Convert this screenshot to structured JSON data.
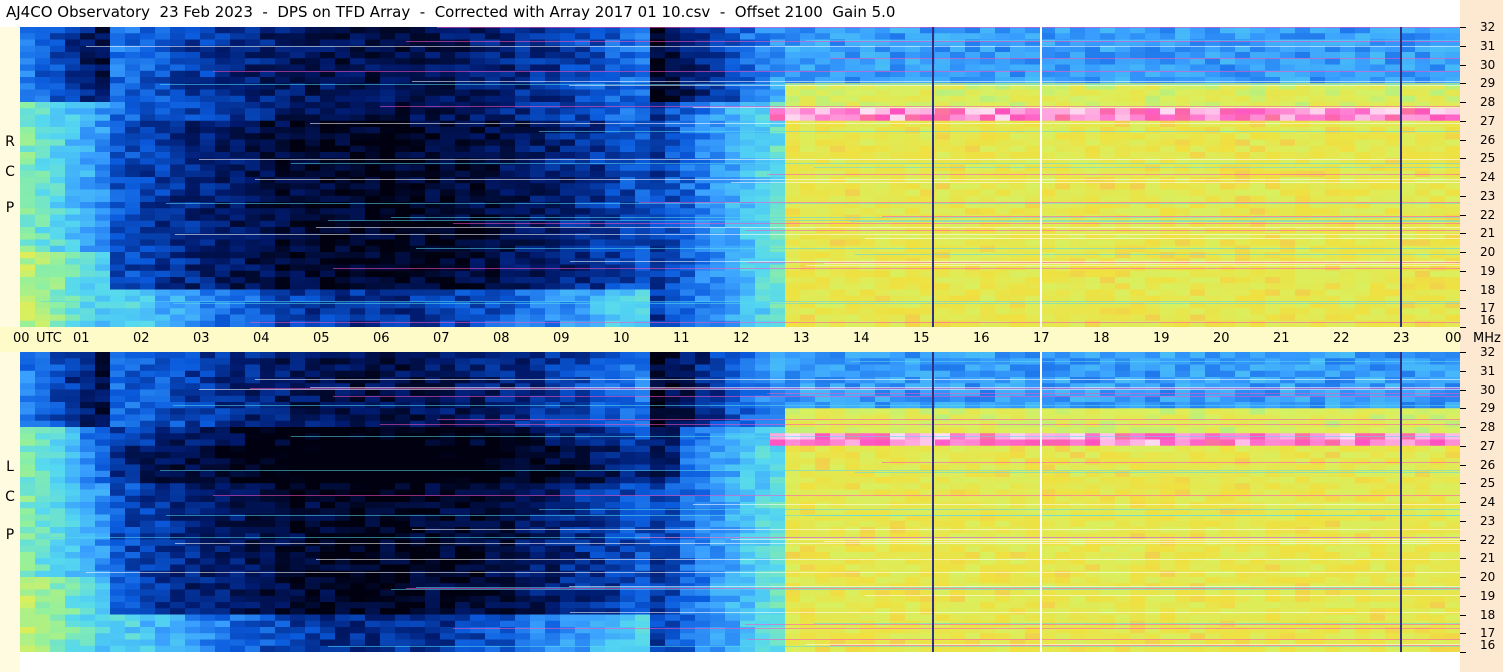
{
  "title": "AJ4CO Observatory  23 Feb 2023  -  DPS on TFD Array  -  Corrected with Array 2017 01 10.csv  -  Offset 2100  Gain 5.0",
  "colors": {
    "background": "#000000",
    "timebar": "#fffbc8",
    "left_gutter": "#fffbe0",
    "right_gutter": "#fde8d2",
    "colormap": [
      "#000010",
      "#001a6e",
      "#0a5adc",
      "#3aa0ff",
      "#55d8f0",
      "#8ff0a0",
      "#d8f060",
      "#f0e040",
      "#ff50c0",
      "#ffffff"
    ]
  },
  "chart_data": {
    "type": "heatmap",
    "title": "AJ4CO Observatory  23 Feb 2023  -  DPS on TFD Array  -  Corrected with Array 2017 01 10.csv  -  Offset 2100  Gain 5.0",
    "x_axis": {
      "unit_label": "UTC",
      "range": [
        0,
        24
      ],
      "tick_labels": [
        "00",
        "01",
        "02",
        "03",
        "04",
        "05",
        "06",
        "07",
        "08",
        "09",
        "10",
        "11",
        "12",
        "13",
        "14",
        "15",
        "16",
        "17",
        "18",
        "19",
        "20",
        "21",
        "22",
        "23",
        "00"
      ]
    },
    "y_axis": {
      "unit_label": "MHz",
      "range": [
        16,
        32
      ],
      "tick_labels": [
        "16",
        "17",
        "18",
        "19",
        "20",
        "21",
        "22",
        "23",
        "24",
        "25",
        "26",
        "27",
        "28",
        "29",
        "30",
        "31",
        "32"
      ]
    },
    "panels": [
      {
        "polarization": "RCP",
        "side_label": [
          "R",
          "C",
          "P"
        ]
      },
      {
        "polarization": "LCP",
        "side_label": [
          "L",
          "C",
          "P"
        ]
      }
    ],
    "features": {
      "quiet_night_hours": [
        1.5,
        10.5
      ],
      "daytime_enhanced_hours": [
        12.8,
        24
      ],
      "interference_band_mhz": 27.2,
      "vertical_events_utc": [
        15.2,
        17.0,
        23.0
      ]
    },
    "grid": false,
    "legend": "none"
  }
}
